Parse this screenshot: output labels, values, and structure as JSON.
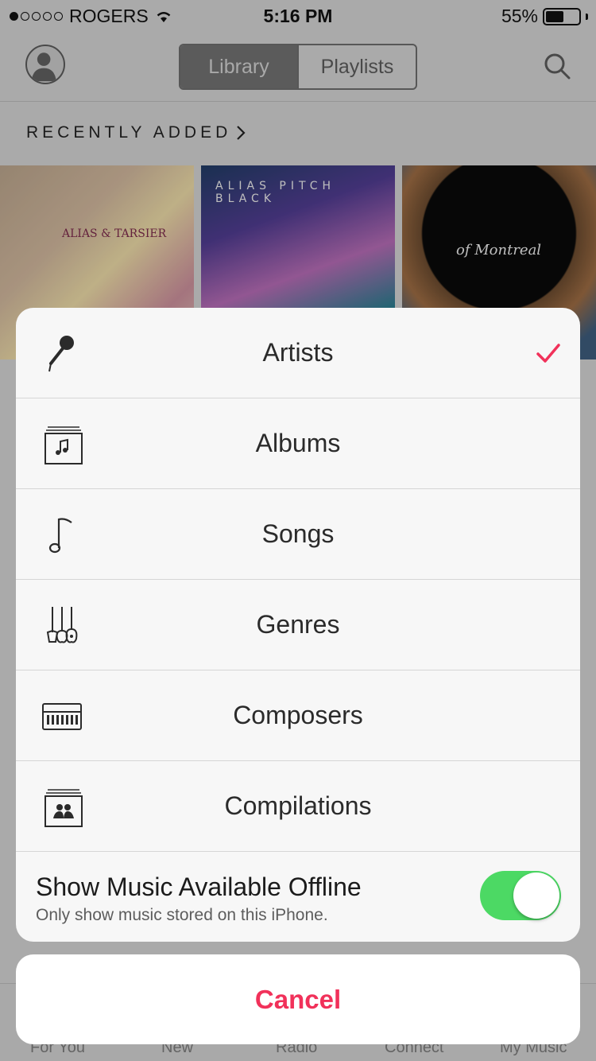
{
  "status_bar": {
    "carrier": "ROGERS",
    "time": "5:16 PM",
    "battery": "55%",
    "battery_level": 0.55,
    "signal_strength": 1
  },
  "nav": {
    "segments": [
      "Library",
      "Playlists"
    ],
    "selected_segment": "Library"
  },
  "section": {
    "title": "RECENTLY ADDED"
  },
  "albums": [
    {
      "art_text": "ALIAS & TARSIER"
    },
    {
      "art_text": "ALIAS PITCH BLACK"
    },
    {
      "art_text": "of Montreal"
    }
  ],
  "action_sheet": {
    "items": [
      {
        "label": "Artists",
        "icon": "microphone-icon",
        "selected": true
      },
      {
        "label": "Albums",
        "icon": "album-icon",
        "selected": false
      },
      {
        "label": "Songs",
        "icon": "music-note-icon",
        "selected": false
      },
      {
        "label": "Genres",
        "icon": "guitars-icon",
        "selected": false
      },
      {
        "label": "Composers",
        "icon": "piano-icon",
        "selected": false
      },
      {
        "label": "Compilations",
        "icon": "compilation-icon",
        "selected": false
      }
    ],
    "offline_toggle": {
      "title": "Show Music Available Offline",
      "subtitle": "Only show music stored on this iPhone.",
      "on": true
    },
    "cancel_label": "Cancel"
  },
  "tab_bar": {
    "items": [
      "For You",
      "New",
      "Radio",
      "Connect",
      "My Music"
    ]
  },
  "colors": {
    "accent": "#f1315a",
    "toggle_on": "#4cd964"
  }
}
